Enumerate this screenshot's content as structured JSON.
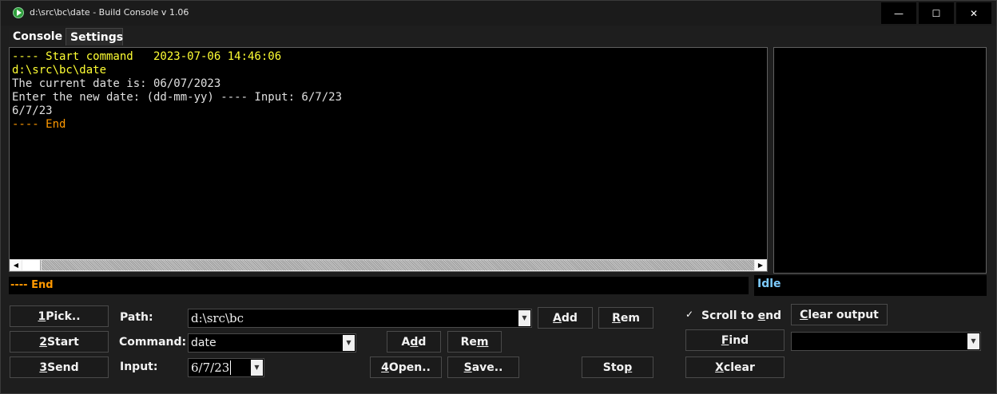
{
  "window": {
    "title": "d:\\src\\bc\\date - Build Console v 1.06",
    "minimize": "—",
    "maximize": "☐",
    "close": "✕"
  },
  "tabs": [
    {
      "label": "Console"
    },
    {
      "label": "Settings"
    }
  ],
  "console": {
    "lines": [
      {
        "text": "---- Start command   2023-07-06 14:46:06",
        "color": "#ffff33"
      },
      {
        "text": "d:\\src\\bc\\date",
        "color": "#ffff33"
      },
      {
        "text": "The current date is: 06/07/2023",
        "color": "#e0e0e0"
      },
      {
        "text": "Enter the new date: (dd-mm-yy) ---- Input: 6/7/23",
        "color": "#e0e0e0"
      },
      {
        "text": "6/7/23",
        "color": "#e0e0e0"
      },
      {
        "text": "---- End",
        "color": "#ff9900"
      }
    ]
  },
  "status": {
    "last_line": "---- End",
    "state": "Idle"
  },
  "buttons": {
    "pick_num": "1",
    "pick_rest": " Pick..",
    "start_num": "2",
    "start_rest": " Start",
    "send_num": "3",
    "send_rest": " Send",
    "path_add_pre": "",
    "path_add_u": "A",
    "path_add_post": "dd",
    "path_rem_pre": "",
    "path_rem_u": "R",
    "path_rem_post": "em",
    "cmd_add_pre": "A",
    "cmd_add_u": "d",
    "cmd_add_post": "d",
    "cmd_rem_pre": "Re",
    "cmd_rem_u": "m",
    "cmd_rem_post": "",
    "open_num": "4",
    "open_rest": " Open..",
    "save_pre": "",
    "save_u": "S",
    "save_post": "ave..",
    "stop_pre": "Sto",
    "stop_u": "p",
    "stop_post": "",
    "clear_output_pre": "",
    "clear_output_u": "C",
    "clear_output_post": "lear output",
    "find_pre": "",
    "find_u": "F",
    "find_post": "ind",
    "x_clear_pre": "",
    "x_clear_u": "X",
    "x_clear_post": " clear"
  },
  "labels": {
    "path": "Path:",
    "command": "Command:",
    "input": "Input:",
    "scroll_to_end_pre": "Scroll to ",
    "scroll_to_end_u": "e",
    "scroll_to_end_post": "nd"
  },
  "fields": {
    "path_value": "d:\\src\\bc",
    "command_value": "date",
    "input_value": "6/7/23",
    "find_value": ""
  },
  "scroll_to_end_checked": true
}
